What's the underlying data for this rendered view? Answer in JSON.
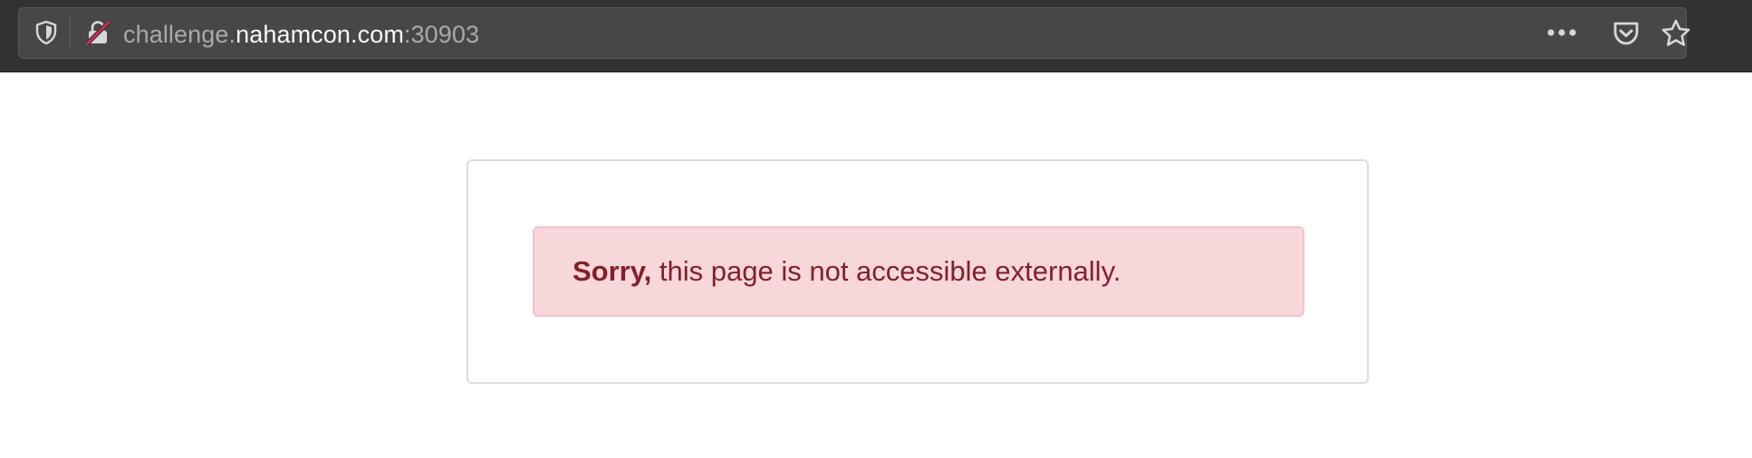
{
  "browser": {
    "url_prefix": "challenge.",
    "url_host": "nahamcon.com",
    "url_port": ":30903",
    "icons": {
      "tracking_protection": "shield-icon",
      "insecure_connection": "insecure-lock-icon",
      "page_actions": "more-horizontal-icon",
      "pocket": "pocket-icon",
      "bookmark": "star-icon"
    }
  },
  "page": {
    "alert_strong": "Sorry,",
    "alert_text": " this page is not accessible externally."
  },
  "colors": {
    "toolbar_bg": "#323234",
    "urlbar_bg": "#474749",
    "alert_bg": "#f8d7da",
    "alert_border": "#f5c2c7",
    "alert_text": "#842029",
    "insecure_slash": "#e22850"
  }
}
